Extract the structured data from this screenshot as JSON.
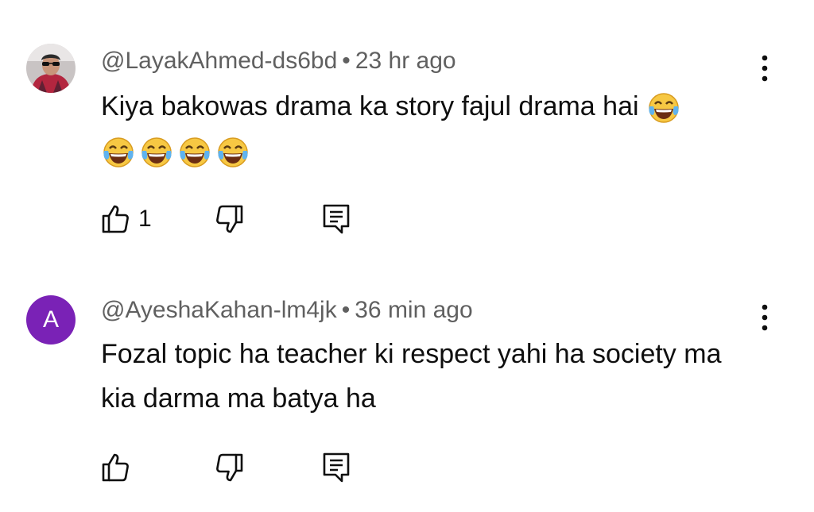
{
  "comments": [
    {
      "author": "@LayakAhmed-ds6bd",
      "separator": "•",
      "time": "23 hr ago",
      "text": "Kiya bakowas drama ka story fajul drama hai",
      "avatar": "photo",
      "emoji": "face-with-tears-of-joy",
      "emoji_count": 5,
      "likes": "1"
    },
    {
      "author": "@AyeshaKahan-lm4jk",
      "separator": "•",
      "time": "36 min ago",
      "text": "Fozal topic ha teacher ki respect yahi ha society ma kia darma ma batya ha",
      "avatar_letter": "A",
      "avatar_color": "#7a22b6",
      "likes": ""
    }
  ],
  "icons": {
    "more": "more-vert-icon",
    "like": "thumbs-up-icon",
    "dislike": "thumbs-down-icon",
    "reply": "reply-comment-icon"
  }
}
